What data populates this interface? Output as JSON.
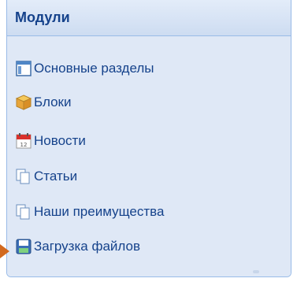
{
  "panel": {
    "title": "Модули",
    "items": [
      {
        "label": "Основные разделы",
        "icon": "window-layout-icon"
      },
      {
        "label": "Блоки",
        "icon": "box-icon"
      },
      {
        "label": "Новости",
        "icon": "calendar-icon"
      },
      {
        "label": "Статьи",
        "icon": "documents-icon"
      },
      {
        "label": "Наши преимущества",
        "icon": "documents-icon"
      },
      {
        "label": "Загрузка файлов",
        "icon": "floppy-disk-icon"
      }
    ]
  },
  "colors": {
    "title": "#15428b",
    "item_text": "#15428b",
    "border": "#99bbe8",
    "body_bg": "#dfe8f6",
    "pointer": "#d2691e"
  }
}
